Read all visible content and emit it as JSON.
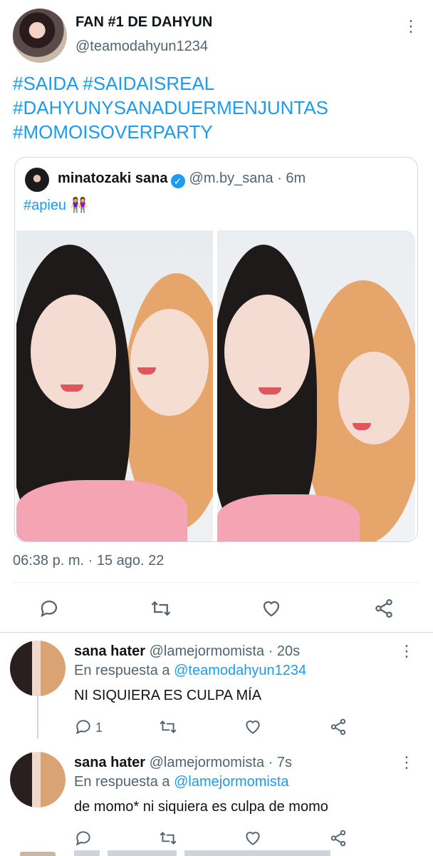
{
  "tweet": {
    "display_name": "FAN #1 DE DAHYUN",
    "handle": "@teamodahyun1234",
    "hashtags": [
      "#SAIDA #SAIDAISREAL",
      "#DAHYUNYSANADUERMENJUNTAS",
      "#MOMOISOVERPARTY"
    ],
    "timestamp": "06:38 p. m. · 15 ago. 22",
    "more_icon": "more-vertical-icon"
  },
  "quote": {
    "display_name": "minatozaki sana",
    "verified_icon": "verified-badge-icon",
    "handle_time": "@m.by_sana · 6m",
    "text": "#apieu",
    "emoji": "👭"
  },
  "actions": {
    "icons": [
      "reply-icon",
      "retweet-icon",
      "like-icon",
      "share-icon"
    ]
  },
  "replies": [
    {
      "display_name": "sana hater",
      "handle_time": "@lamejormomista · 20s",
      "reply_prefix": "En respuesta a",
      "reply_to": "@teamodahyun1234",
      "text": "NI SIQUIERA ES CULPA MÍA",
      "reply_count": "1"
    },
    {
      "display_name": "sana hater",
      "handle_time": "@lamejormomista · 7s",
      "reply_prefix": "En respuesta a",
      "reply_to": "@lamejormomista",
      "text": "de momo* ni siquiera es culpa de momo",
      "reply_count": ""
    }
  ],
  "colors": {
    "accent": "#1d9bf0",
    "muted": "#536471",
    "border": "#cfd9de"
  }
}
